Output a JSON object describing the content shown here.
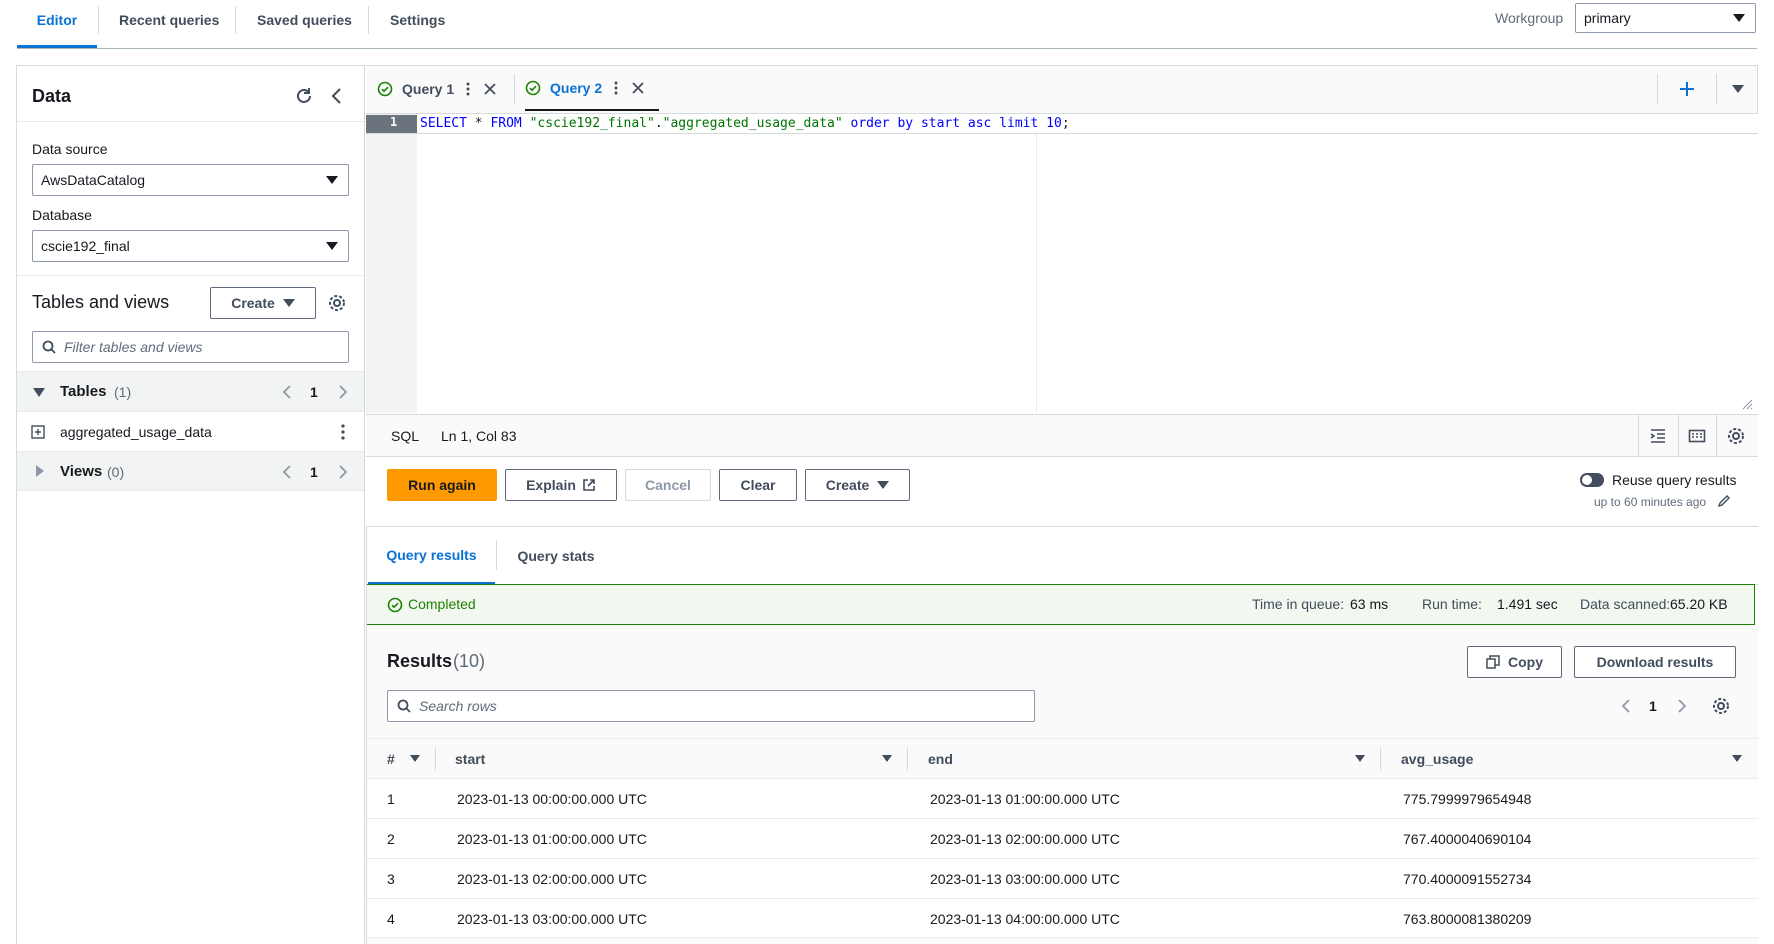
{
  "nav": {
    "tabs": [
      "Editor",
      "Recent queries",
      "Saved queries",
      "Settings"
    ],
    "workgroup_label": "Workgroup",
    "workgroup_value": "primary"
  },
  "left": {
    "title": "Data",
    "data_source_label": "Data source",
    "data_source_value": "AwsDataCatalog",
    "database_label": "Database",
    "database_value": "cscie192_final",
    "tables_views_title": "Tables and views",
    "create_label": "Create",
    "filter_placeholder": "Filter tables and views",
    "tables_label": "Tables",
    "tables_count": "(1)",
    "tables_page": "1",
    "table_item": "aggregated_usage_data",
    "views_label": "Views",
    "views_count": "(0)",
    "views_page": "1"
  },
  "editor": {
    "tabs": [
      "Query 1",
      "Query 2"
    ],
    "line_number": "1",
    "sql": {
      "kw1": "SELECT",
      "star": " * ",
      "kw2": "FROM",
      "db": " \"cscie192_final\"",
      "dot": ".",
      "table": "\"aggregated_usage_data\"",
      "rest": " order by start asc limit ",
      "num": "10",
      "semi": ";"
    },
    "lang": "SQL",
    "cursor": "Ln 1, Col 83"
  },
  "actions": {
    "run": "Run again",
    "explain": "Explain",
    "cancel": "Cancel",
    "clear": "Clear",
    "create": "Create",
    "reuse_label": "Reuse query results",
    "reuse_sub": "up to 60 minutes ago"
  },
  "results_tabs": [
    "Query results",
    "Query stats"
  ],
  "status": {
    "text": "Completed",
    "queue_label": "Time in queue:",
    "queue_value": "63 ms",
    "run_label": "Run time:",
    "run_value": "1.491 sec",
    "scanned_label": "Data scanned:",
    "scanned_value": "65.20 KB"
  },
  "results": {
    "title": "Results",
    "count": "(10)",
    "copy": "Copy",
    "download": "Download results",
    "search_placeholder": "Search rows",
    "page": "1",
    "columns": [
      "#",
      "start",
      "end",
      "avg_usage"
    ],
    "rows": [
      [
        "1",
        "2023-01-13 00:00:00.000 UTC",
        "2023-01-13 01:00:00.000 UTC",
        "775.7999979654948"
      ],
      [
        "2",
        "2023-01-13 01:00:00.000 UTC",
        "2023-01-13 02:00:00.000 UTC",
        "767.4000040690104"
      ],
      [
        "3",
        "2023-01-13 02:00:00.000 UTC",
        "2023-01-13 03:00:00.000 UTC",
        "770.4000091552734"
      ],
      [
        "4",
        "2023-01-13 03:00:00.000 UTC",
        "2023-01-13 04:00:00.000 UTC",
        "763.8000081380209"
      ]
    ]
  },
  "colors": {
    "accent": "#0972d3",
    "run_button": "#ff9900",
    "success": "#1d8102",
    "sql_keyword": "#0000ff",
    "sql_string": "#007400"
  }
}
